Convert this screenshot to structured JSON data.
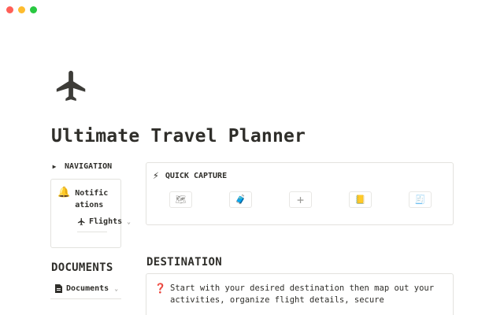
{
  "window": {
    "controls": [
      "close",
      "minimize",
      "zoom"
    ]
  },
  "page": {
    "icon": "airplane-icon",
    "title": "Ultimate Travel Planner"
  },
  "sidebar": {
    "navigation_label": "NAVIGATION",
    "nav_items": [
      {
        "icon": "bell-icon",
        "glyph": "🔔",
        "label": "Notifications"
      },
      {
        "icon": "airplane-icon",
        "label": "Flights"
      }
    ],
    "documents_heading": "DOCUMENTS",
    "documents_link": {
      "icon": "document-icon",
      "label": "Documents"
    }
  },
  "quick_capture": {
    "icon_glyph": "⚡",
    "title": "QUICK CAPTURE",
    "buttons": [
      {
        "icon": "map-icon",
        "glyph": "🗺"
      },
      {
        "icon": "suitcase-icon",
        "glyph": "🧳"
      },
      {
        "icon": "plus-icon",
        "glyph": "+"
      },
      {
        "icon": "notebook-icon",
        "glyph": "📒"
      },
      {
        "icon": "receipt-icon",
        "glyph": "🧾"
      }
    ]
  },
  "destination": {
    "heading": "DESTINATION",
    "callout_icon": "question-icon",
    "callout_glyph": "❓",
    "callout_text": "Start with your desired destination then map out your activities, organize flight details, secure"
  }
}
